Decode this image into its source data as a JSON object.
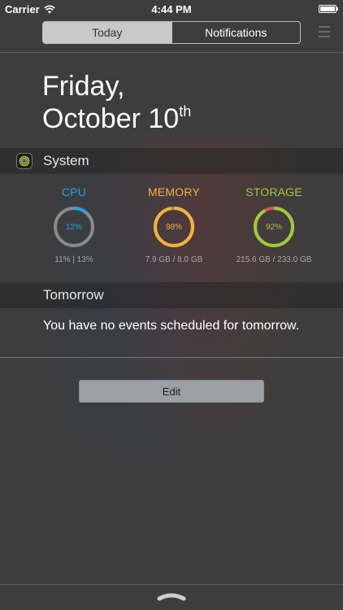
{
  "status_bar": {
    "carrier": "Carrier",
    "time": "4:44 PM"
  },
  "segmented": {
    "today": "Today",
    "notifications": "Notifications"
  },
  "date": {
    "line1": "Friday,",
    "line2": "October 10",
    "suffix": "th"
  },
  "system": {
    "title": "System",
    "gauges": [
      {
        "label": "CPU",
        "percent_text": "12%",
        "value": 12,
        "detail": "11% | 13%",
        "color": "#2a9fe0"
      },
      {
        "label": "MEMORY",
        "percent_text": "98%",
        "value": 98,
        "detail": "7.9 GB / 8.0 GB",
        "color": "#f5b13c"
      },
      {
        "label": "STORAGE",
        "percent_text": "92%",
        "value": 92,
        "detail": "215.6 GB / 233.0 GB",
        "color": "#9ccb3b"
      }
    ],
    "ring_track_color": "#8a8a8a",
    "storage_warning_color": "#d9534f"
  },
  "tomorrow": {
    "title": "Tomorrow",
    "message": "You have no events scheduled for tomorrow."
  },
  "edit_button": {
    "label": "Edit"
  },
  "icons": {
    "wifi": "wifi-icon",
    "battery": "battery-icon",
    "app": "system-app-icon",
    "handle": "chevron-up-handle-icon"
  }
}
